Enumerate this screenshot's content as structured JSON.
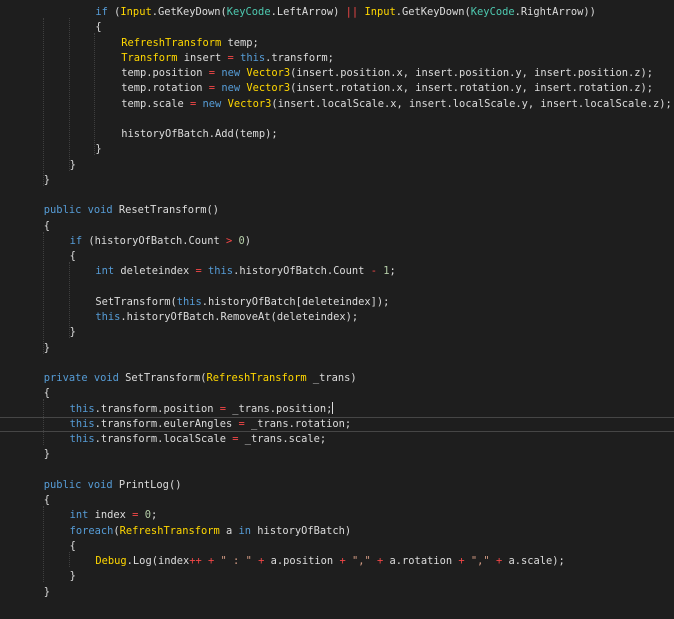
{
  "editor": {
    "theme": {
      "background": "#1e1e1e"
    },
    "colors": {
      "kw": "#569cd6",
      "ty": "#4ec9b0",
      "cls": "#ffd700",
      "op": "#b4b4b4",
      "red": "#f44747",
      "num": "#b5cea8",
      "str": "#d69d85",
      "fn": "#dcdcaa",
      "txt": "#dcdcdc",
      "pun": "#b4b4b4"
    },
    "current_line": 27,
    "lines": [
      {
        "indent": 12,
        "tokens": [
          {
            "t": "if",
            "k": "kw"
          },
          {
            "t": " (",
            "k": "txt"
          },
          {
            "t": "Input",
            "k": "cls"
          },
          {
            "t": ".GetKeyDown(",
            "k": "txt"
          },
          {
            "t": "KeyCode",
            "k": "ty"
          },
          {
            "t": ".LeftArrow) ",
            "k": "txt"
          },
          {
            "t": "||",
            "k": "red"
          },
          {
            "t": " ",
            "k": "txt"
          },
          {
            "t": "Input",
            "k": "cls"
          },
          {
            "t": ".GetKeyDown(",
            "k": "txt"
          },
          {
            "t": "KeyCode",
            "k": "ty"
          },
          {
            "t": ".RightArrow))",
            "k": "txt"
          }
        ]
      },
      {
        "indent": 12,
        "tokens": [
          {
            "t": "{",
            "k": "txt"
          }
        ]
      },
      {
        "indent": 16,
        "tokens": [
          {
            "t": "RefreshTransform",
            "k": "cls"
          },
          {
            "t": " temp;",
            "k": "txt"
          }
        ]
      },
      {
        "indent": 16,
        "tokens": [
          {
            "t": "Transform",
            "k": "cls"
          },
          {
            "t": " insert ",
            "k": "txt"
          },
          {
            "t": "=",
            "k": "red"
          },
          {
            "t": " ",
            "k": "txt"
          },
          {
            "t": "this",
            "k": "kw"
          },
          {
            "t": ".transform;",
            "k": "txt"
          }
        ]
      },
      {
        "indent": 16,
        "tokens": [
          {
            "t": "temp.position ",
            "k": "txt"
          },
          {
            "t": "=",
            "k": "red"
          },
          {
            "t": " ",
            "k": "txt"
          },
          {
            "t": "new",
            "k": "kw"
          },
          {
            "t": " ",
            "k": "txt"
          },
          {
            "t": "Vector3",
            "k": "cls"
          },
          {
            "t": "(insert.position.x, insert.position.y, insert.position.z);",
            "k": "txt"
          }
        ]
      },
      {
        "indent": 16,
        "tokens": [
          {
            "t": "temp.rotation ",
            "k": "txt"
          },
          {
            "t": "=",
            "k": "red"
          },
          {
            "t": " ",
            "k": "txt"
          },
          {
            "t": "new",
            "k": "kw"
          },
          {
            "t": " ",
            "k": "txt"
          },
          {
            "t": "Vector3",
            "k": "cls"
          },
          {
            "t": "(insert.rotation.x, insert.rotation.y, insert.rotation.z);",
            "k": "txt"
          }
        ]
      },
      {
        "indent": 16,
        "tokens": [
          {
            "t": "temp.scale ",
            "k": "txt"
          },
          {
            "t": "=",
            "k": "red"
          },
          {
            "t": " ",
            "k": "txt"
          },
          {
            "t": "new",
            "k": "kw"
          },
          {
            "t": " ",
            "k": "txt"
          },
          {
            "t": "Vector3",
            "k": "cls"
          },
          {
            "t": "(insert.localScale.x, insert.localScale.y, insert.localScale.z);",
            "k": "txt"
          }
        ]
      },
      {
        "indent": 0,
        "tokens": []
      },
      {
        "indent": 16,
        "tokens": [
          {
            "t": "historyOfBatch.Add(temp);",
            "k": "txt"
          }
        ]
      },
      {
        "indent": 12,
        "tokens": [
          {
            "t": "}",
            "k": "txt"
          }
        ]
      },
      {
        "indent": 8,
        "tokens": [
          {
            "t": "}",
            "k": "txt"
          }
        ]
      },
      {
        "indent": 4,
        "tokens": [
          {
            "t": "}",
            "k": "txt"
          }
        ]
      },
      {
        "indent": 0,
        "tokens": []
      },
      {
        "indent": 4,
        "tokens": [
          {
            "t": "public",
            "k": "kw"
          },
          {
            "t": " ",
            "k": "txt"
          },
          {
            "t": "void",
            "k": "kw"
          },
          {
            "t": " ResetTransform()",
            "k": "txt"
          }
        ]
      },
      {
        "indent": 4,
        "tokens": [
          {
            "t": "{",
            "k": "txt"
          }
        ]
      },
      {
        "indent": 8,
        "tokens": [
          {
            "t": "if",
            "k": "kw"
          },
          {
            "t": " (historyOfBatch.Count ",
            "k": "txt"
          },
          {
            "t": ">",
            "k": "red"
          },
          {
            "t": " ",
            "k": "txt"
          },
          {
            "t": "0",
            "k": "num"
          },
          {
            "t": ")",
            "k": "txt"
          }
        ]
      },
      {
        "indent": 8,
        "tokens": [
          {
            "t": "{",
            "k": "txt"
          }
        ]
      },
      {
        "indent": 12,
        "tokens": [
          {
            "t": "int",
            "k": "kw"
          },
          {
            "t": " deleteindex ",
            "k": "txt"
          },
          {
            "t": "=",
            "k": "red"
          },
          {
            "t": " ",
            "k": "txt"
          },
          {
            "t": "this",
            "k": "kw"
          },
          {
            "t": ".historyOfBatch.Count ",
            "k": "txt"
          },
          {
            "t": "-",
            "k": "red"
          },
          {
            "t": " ",
            "k": "txt"
          },
          {
            "t": "1",
            "k": "num"
          },
          {
            "t": ";",
            "k": "txt"
          }
        ]
      },
      {
        "indent": 0,
        "tokens": []
      },
      {
        "indent": 12,
        "tokens": [
          {
            "t": "SetTransform(",
            "k": "txt"
          },
          {
            "t": "this",
            "k": "kw"
          },
          {
            "t": ".historyOfBatch[deleteindex]);",
            "k": "txt"
          }
        ]
      },
      {
        "indent": 12,
        "tokens": [
          {
            "t": "this",
            "k": "kw"
          },
          {
            "t": ".historyOfBatch.RemoveAt(deleteindex);",
            "k": "txt"
          }
        ]
      },
      {
        "indent": 8,
        "tokens": [
          {
            "t": "}",
            "k": "txt"
          }
        ]
      },
      {
        "indent": 4,
        "tokens": [
          {
            "t": "}",
            "k": "txt"
          }
        ]
      },
      {
        "indent": 0,
        "tokens": []
      },
      {
        "indent": 4,
        "tokens": [
          {
            "t": "private",
            "k": "kw"
          },
          {
            "t": " ",
            "k": "txt"
          },
          {
            "t": "void",
            "k": "kw"
          },
          {
            "t": " SetTransform(",
            "k": "txt"
          },
          {
            "t": "RefreshTransform",
            "k": "cls"
          },
          {
            "t": " _trans)",
            "k": "txt"
          }
        ]
      },
      {
        "indent": 4,
        "tokens": [
          {
            "t": "{",
            "k": "txt"
          }
        ]
      },
      {
        "indent": 8,
        "tokens": [
          {
            "t": "this",
            "k": "kw"
          },
          {
            "t": ".transform.position ",
            "k": "txt"
          },
          {
            "t": "=",
            "k": "red"
          },
          {
            "t": " _trans.position;",
            "k": "txt"
          }
        ],
        "caret": true
      },
      {
        "indent": 8,
        "tokens": [
          {
            "t": "this",
            "k": "kw"
          },
          {
            "t": ".transform.eulerAngles ",
            "k": "txt"
          },
          {
            "t": "=",
            "k": "red"
          },
          {
            "t": " _trans.rotation;",
            "k": "txt"
          }
        ]
      },
      {
        "indent": 8,
        "tokens": [
          {
            "t": "this",
            "k": "kw"
          },
          {
            "t": ".transform.localScale ",
            "k": "txt"
          },
          {
            "t": "=",
            "k": "red"
          },
          {
            "t": " _trans.scale;",
            "k": "txt"
          }
        ]
      },
      {
        "indent": 4,
        "tokens": [
          {
            "t": "}",
            "k": "txt"
          }
        ]
      },
      {
        "indent": 0,
        "tokens": []
      },
      {
        "indent": 4,
        "tokens": [
          {
            "t": "public",
            "k": "kw"
          },
          {
            "t": " ",
            "k": "txt"
          },
          {
            "t": "void",
            "k": "kw"
          },
          {
            "t": " PrintLog()",
            "k": "txt"
          }
        ]
      },
      {
        "indent": 4,
        "tokens": [
          {
            "t": "{",
            "k": "txt"
          }
        ]
      },
      {
        "indent": 8,
        "tokens": [
          {
            "t": "int",
            "k": "kw"
          },
          {
            "t": " index ",
            "k": "txt"
          },
          {
            "t": "=",
            "k": "red"
          },
          {
            "t": " ",
            "k": "txt"
          },
          {
            "t": "0",
            "k": "num"
          },
          {
            "t": ";",
            "k": "txt"
          }
        ]
      },
      {
        "indent": 8,
        "tokens": [
          {
            "t": "foreach",
            "k": "kw"
          },
          {
            "t": "(",
            "k": "txt"
          },
          {
            "t": "RefreshTransform",
            "k": "cls"
          },
          {
            "t": " a ",
            "k": "txt"
          },
          {
            "t": "in",
            "k": "kw"
          },
          {
            "t": " historyOfBatch)",
            "k": "txt"
          }
        ]
      },
      {
        "indent": 8,
        "tokens": [
          {
            "t": "{",
            "k": "txt"
          }
        ]
      },
      {
        "indent": 12,
        "tokens": [
          {
            "t": "Debug",
            "k": "cls"
          },
          {
            "t": ".Log(index",
            "k": "txt"
          },
          {
            "t": "++",
            "k": "red"
          },
          {
            "t": " ",
            "k": "txt"
          },
          {
            "t": "+",
            "k": "red"
          },
          {
            "t": " ",
            "k": "txt"
          },
          {
            "t": "\" : \"",
            "k": "str"
          },
          {
            "t": " ",
            "k": "txt"
          },
          {
            "t": "+",
            "k": "red"
          },
          {
            "t": " a.position ",
            "k": "txt"
          },
          {
            "t": "+",
            "k": "red"
          },
          {
            "t": " ",
            "k": "txt"
          },
          {
            "t": "\",\"",
            "k": "str"
          },
          {
            "t": " ",
            "k": "txt"
          },
          {
            "t": "+",
            "k": "red"
          },
          {
            "t": " a.rotation ",
            "k": "txt"
          },
          {
            "t": "+",
            "k": "red"
          },
          {
            "t": " ",
            "k": "txt"
          },
          {
            "t": "\",\"",
            "k": "str"
          },
          {
            "t": " ",
            "k": "txt"
          },
          {
            "t": "+",
            "k": "red"
          },
          {
            "t": " a.scale);",
            "k": "txt"
          }
        ]
      },
      {
        "indent": 8,
        "tokens": [
          {
            "t": "}",
            "k": "txt"
          }
        ]
      },
      {
        "indent": 4,
        "tokens": [
          {
            "t": "}",
            "k": "txt"
          }
        ]
      }
    ]
  }
}
